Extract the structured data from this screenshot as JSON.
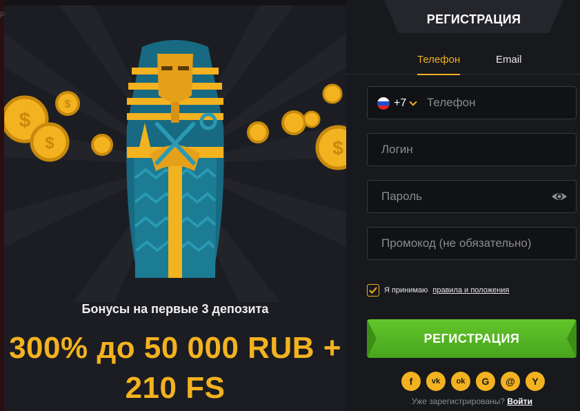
{
  "backdrop": {
    "label": "р"
  },
  "promo": {
    "subtitle": "Бонусы на первые 3 депозита",
    "amount_line1": "300% до 50 000 RUB +",
    "amount_line2": "210 FS",
    "accent_color": "#f3b21f"
  },
  "form": {
    "title": "РЕГИСТРАЦИЯ",
    "tabs": [
      {
        "label": "Телефон",
        "active": true
      },
      {
        "label": "Email",
        "active": false
      }
    ],
    "phone": {
      "country_code": "+7",
      "flag_icon": "russia-flag-icon",
      "placeholder": "Телефон"
    },
    "login": {
      "placeholder": "Логин"
    },
    "password": {
      "placeholder": "Пароль",
      "icon": "eye-icon"
    },
    "promocode": {
      "placeholder": "Промокод (не обязательно)"
    },
    "agree": {
      "text": "Я принимаю",
      "link": "правила и положения",
      "checked": true
    },
    "submit_label": "РЕГИСТРАЦИЯ",
    "submit_color": "#55b524",
    "socials": [
      {
        "name": "facebook-icon",
        "glyph": "f"
      },
      {
        "name": "vk-icon",
        "glyph": "vk"
      },
      {
        "name": "odnoklassniki-icon",
        "glyph": "ok"
      },
      {
        "name": "google-icon",
        "glyph": "G"
      },
      {
        "name": "mail-icon",
        "glyph": "@"
      },
      {
        "name": "yandex-icon",
        "glyph": "Y"
      }
    ],
    "already_text": "Уже зарегистрированы?",
    "login_link": "Войти"
  }
}
